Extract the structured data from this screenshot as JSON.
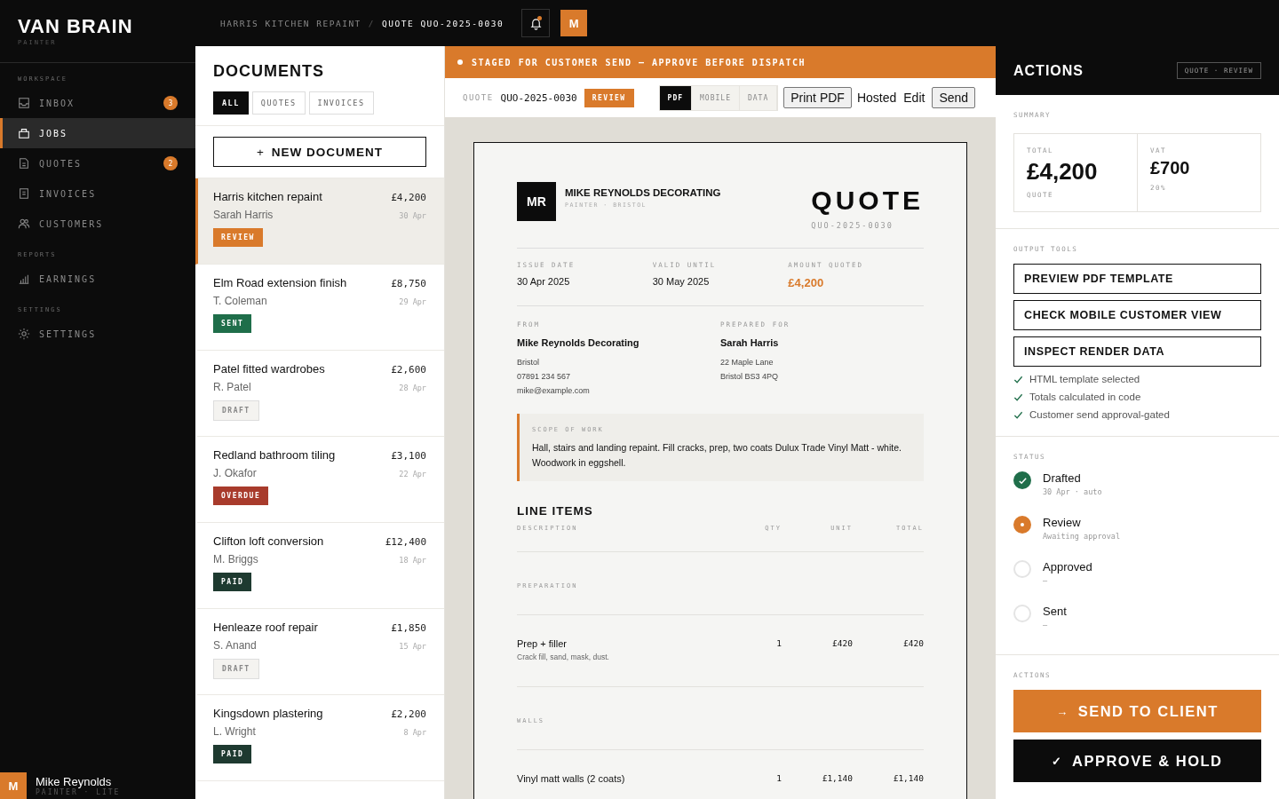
{
  "brand": {
    "name": "VAN BRAIN",
    "tagline": "PAINTER"
  },
  "sidebar": {
    "sections": [
      {
        "label": "WORKSPACE",
        "items": [
          {
            "label": "INBOX",
            "badge": "3",
            "selected": false
          },
          {
            "label": "JOBS",
            "selected": true
          },
          {
            "label": "QUOTES",
            "badge": "2",
            "selected": false
          },
          {
            "label": "INVOICES",
            "selected": false
          },
          {
            "label": "CUSTOMERS",
            "selected": false
          }
        ]
      },
      {
        "label": "REPORTS",
        "items": [
          {
            "label": "EARNINGS",
            "selected": false
          }
        ]
      },
      {
        "label": "SETTINGS",
        "items": [
          {
            "label": "SETTINGS",
            "selected": false
          }
        ]
      }
    ],
    "user": {
      "initial": "M",
      "name": "Mike Reynolds",
      "plan": "PAINTER · LITE"
    }
  },
  "topbar": {
    "breadcrumb": [
      "HARRIS KITCHEN REPAINT",
      "QUOTE QUO-2025-0030"
    ],
    "separator": "/",
    "notification": true,
    "avatar": "M"
  },
  "documents": {
    "title": "DOCUMENTS",
    "filters": [
      {
        "label": "ALL",
        "selected": true
      },
      {
        "label": "QUOTES",
        "selected": false
      },
      {
        "label": "INVOICES",
        "selected": false
      }
    ],
    "new_button": "NEW DOCUMENT",
    "new_icon": "+",
    "items": [
      {
        "title": "Harris kitchen repaint",
        "customer": "Sarah Harris",
        "amount": "£4,200",
        "date": "30 Apr",
        "status": "REVIEW",
        "kind": "review",
        "selected": true
      },
      {
        "title": "Elm Road extension finish",
        "customer": "T. Coleman",
        "amount": "£8,750",
        "date": "29 Apr",
        "status": "SENT",
        "kind": "sent",
        "selected": false
      },
      {
        "title": "Patel fitted wardrobes",
        "customer": "R. Patel",
        "amount": "£2,600",
        "date": "28 Apr",
        "status": "DRAFT",
        "kind": "draft",
        "selected": false
      },
      {
        "title": "Redland bathroom tiling",
        "customer": "J. Okafor",
        "amount": "£3,100",
        "date": "22 Apr",
        "status": "OVERDUE",
        "kind": "overdue",
        "selected": false
      },
      {
        "title": "Clifton loft conversion",
        "customer": "M. Briggs",
        "amount": "£12,400",
        "date": "18 Apr",
        "status": "PAID",
        "kind": "paid",
        "selected": false
      },
      {
        "title": "Henleaze roof repair",
        "customer": "S. Anand",
        "amount": "£1,850",
        "date": "15 Apr",
        "status": "DRAFT",
        "kind": "draft",
        "selected": false
      },
      {
        "title": "Kingsdown plastering",
        "customer": "L. Wright",
        "amount": "£2,200",
        "date": "8 Apr",
        "status": "PAID",
        "kind": "paid",
        "selected": false
      }
    ]
  },
  "preview": {
    "banner": "STAGED FOR CUSTOMER SEND — APPROVE BEFORE DISPATCH",
    "toolbar": {
      "doc_label": "QUOTE",
      "doc_number": "QUO-2025-0030",
      "status": "REVIEW",
      "views": [
        {
          "label": "PDF",
          "selected": true
        },
        {
          "label": "MOBILE",
          "selected": false
        },
        {
          "label": "DATA",
          "selected": false
        }
      ],
      "buttons": [
        {
          "label": "Print PDF",
          "kind": "bordered"
        },
        {
          "label": "Hosted",
          "kind": "plain"
        },
        {
          "label": "Edit",
          "kind": "plain"
        },
        {
          "label": "Send",
          "kind": "bordered"
        }
      ]
    },
    "paper": {
      "logo": "MR",
      "company": "MIKE REYNOLDS DECORATING",
      "company_sub": "PAINTER · BRISTOL",
      "doc_type": "QUOTE",
      "doc_number": "QUO-2025-0030",
      "meta": [
        {
          "label": "ISSUE DATE",
          "value": "30 Apr 2025",
          "kind": "plain"
        },
        {
          "label": "VALID UNTIL",
          "value": "30 May 2025",
          "kind": "plain"
        },
        {
          "label": "AMOUNT QUOTED",
          "value": "£4,200",
          "kind": "amount"
        }
      ],
      "from": {
        "label": "FROM",
        "name": "Mike Reynolds Decorating",
        "lines": [
          "Bristol",
          "07891 234 567",
          "mike@example.com"
        ]
      },
      "to": {
        "label": "PREPARED FOR",
        "name": "Sarah Harris",
        "lines": [
          "22 Maple Lane",
          "Bristol BS3 4PQ"
        ]
      },
      "scope": {
        "label": "SCOPE OF WORK",
        "text": "Hall, stairs and landing repaint. Fill cracks, prep, two coats Dulux Trade Vinyl Matt - white. Woodwork in eggshell."
      },
      "line_items": {
        "title": "LINE ITEMS",
        "columns": [
          "DESCRIPTION",
          "QTY",
          "UNIT",
          "TOTAL"
        ],
        "groups": [
          {
            "section": "PREPARATION",
            "items": [
              {
                "description": "Prep + filler",
                "note": "Crack fill, sand, mask, dust.",
                "qty": "1",
                "unit": "£420",
                "total": "£420"
              }
            ]
          },
          {
            "section": "WALLS",
            "items": [
              {
                "description": "Vinyl matt walls (2 coats)",
                "qty": "1",
                "unit": "£1,140",
                "total": "£1,140"
              }
            ]
          }
        ]
      }
    }
  },
  "actions_panel": {
    "title": "ACTIONS",
    "tag": "QUOTE · REVIEW",
    "summary": {
      "label": "SUMMARY",
      "cards": [
        {
          "label": "TOTAL",
          "value": "£4,200",
          "sub": "QUOTE",
          "kind": "big"
        },
        {
          "label": "VAT",
          "value": "£700",
          "sub": "20%",
          "kind": "small"
        }
      ]
    },
    "output_tools": {
      "label": "OUTPUT TOOLS",
      "buttons": [
        "PREVIEW PDF TEMPLATE",
        "CHECK MOBILE CUSTOMER VIEW",
        "INSPECT RENDER DATA"
      ],
      "checks": [
        "HTML template selected",
        "Totals calculated in code",
        "Customer send approval-gated"
      ]
    },
    "status": {
      "label": "STATUS",
      "steps": [
        {
          "name": "Drafted",
          "detail": "30 Apr · auto",
          "done": true,
          "current": false
        },
        {
          "name": "Review",
          "detail": "Awaiting approval",
          "done": false,
          "current": true
        },
        {
          "name": "Approved",
          "detail": "–",
          "done": false,
          "current": false
        },
        {
          "name": "Sent",
          "detail": "–",
          "done": false,
          "current": false
        }
      ]
    },
    "actions": {
      "label": "ACTIONS",
      "buttons": [
        {
          "label": "SEND TO CLIENT",
          "icon": "→",
          "kind": "primary"
        },
        {
          "label": "APPROVE & HOLD",
          "icon": "✓",
          "kind": "dark"
        }
      ]
    }
  }
}
